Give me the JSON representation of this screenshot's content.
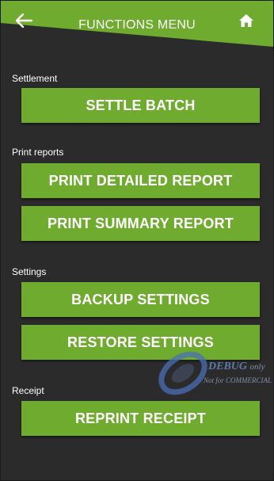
{
  "header": {
    "title": "FUNCTIONS MENU",
    "back_icon": "arrow-left-icon",
    "home_icon": "home-icon"
  },
  "sections": {
    "settlement": {
      "label": "Settlement",
      "buttons": [
        "SETTLE BATCH"
      ]
    },
    "print_reports": {
      "label": "Print reports",
      "buttons": [
        "PRINT DETAILED REPORT",
        "PRINT SUMMARY REPORT"
      ]
    },
    "settings": {
      "label": "Settings",
      "buttons": [
        "BACKUP SETTINGS",
        "RESTORE SETTINGS"
      ]
    },
    "receipt": {
      "label": "Receipt",
      "buttons": [
        "REPRINT RECEIPT"
      ]
    }
  },
  "watermark": {
    "title": "DEBUG",
    "suffix": "only",
    "subtitle": "Not for COMMERCIAL"
  },
  "colors": {
    "accent": "#6fab2e",
    "background": "#2b2b2b",
    "text": "#ffffff"
  }
}
